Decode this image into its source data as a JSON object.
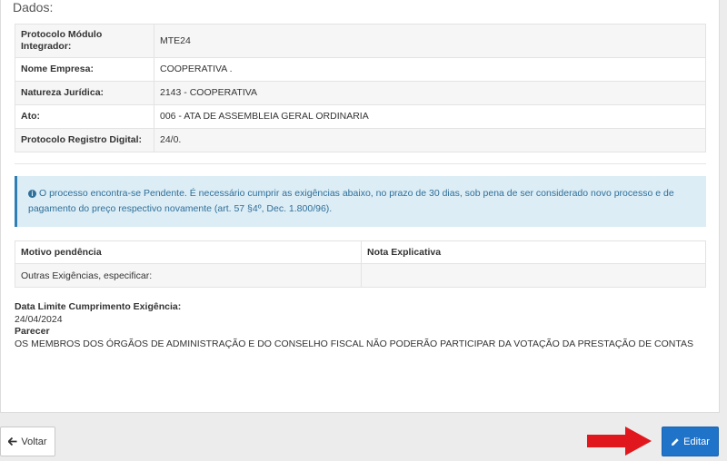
{
  "section": {
    "title": "Dados:"
  },
  "details": [
    {
      "label": "Protocolo Módulo Integrador:",
      "value": "MTE24"
    },
    {
      "label": "Nome Empresa:",
      "value": "COOPERATIVA ."
    },
    {
      "label": "Natureza Jurídica:",
      "value": "2143 - COOPERATIVA"
    },
    {
      "label": "Ato:",
      "value": "006 - ATA DE ASSEMBLEIA GERAL ORDINARIA"
    },
    {
      "label": "Protocolo Registro Digital:",
      "value": "24/0."
    }
  ],
  "alert": {
    "text": "O processo encontra-se Pendente. É necessário cumprir as exigências abaixo, no prazo de 30 dias, sob pena de ser considerado novo processo e de pagamento do preço respectivo novamente (art. 57 §4º, Dec. 1.800/96).",
    "icon": "info-icon"
  },
  "pendencias": {
    "headers": [
      "Motivo pendência",
      "Nota Explicativa"
    ],
    "rows": [
      {
        "motivo": "Outras Exigências, especificar:",
        "nota": ""
      }
    ]
  },
  "cumprimento": {
    "label": "Data Limite Cumprimento Exigência:",
    "date": "24/04/2024",
    "parecer_label": "Parecer",
    "parecer_text": "OS MEMBROS DOS ÓRGÃOS DE ADMINISTRAÇÃO E DO CONSELHO FISCAL NÃO PODERÃO PARTICIPAR DA VOTAÇÃO DA PRESTAÇÃO DE CONTAS"
  },
  "buttons": {
    "voltar_label": "Voltar",
    "editar_label": "Editar"
  },
  "colors": {
    "primary": "#1f73c9",
    "alert_bg": "#dcedf5",
    "alert_text": "#2f6f9a",
    "arrow": "#e0181e"
  }
}
